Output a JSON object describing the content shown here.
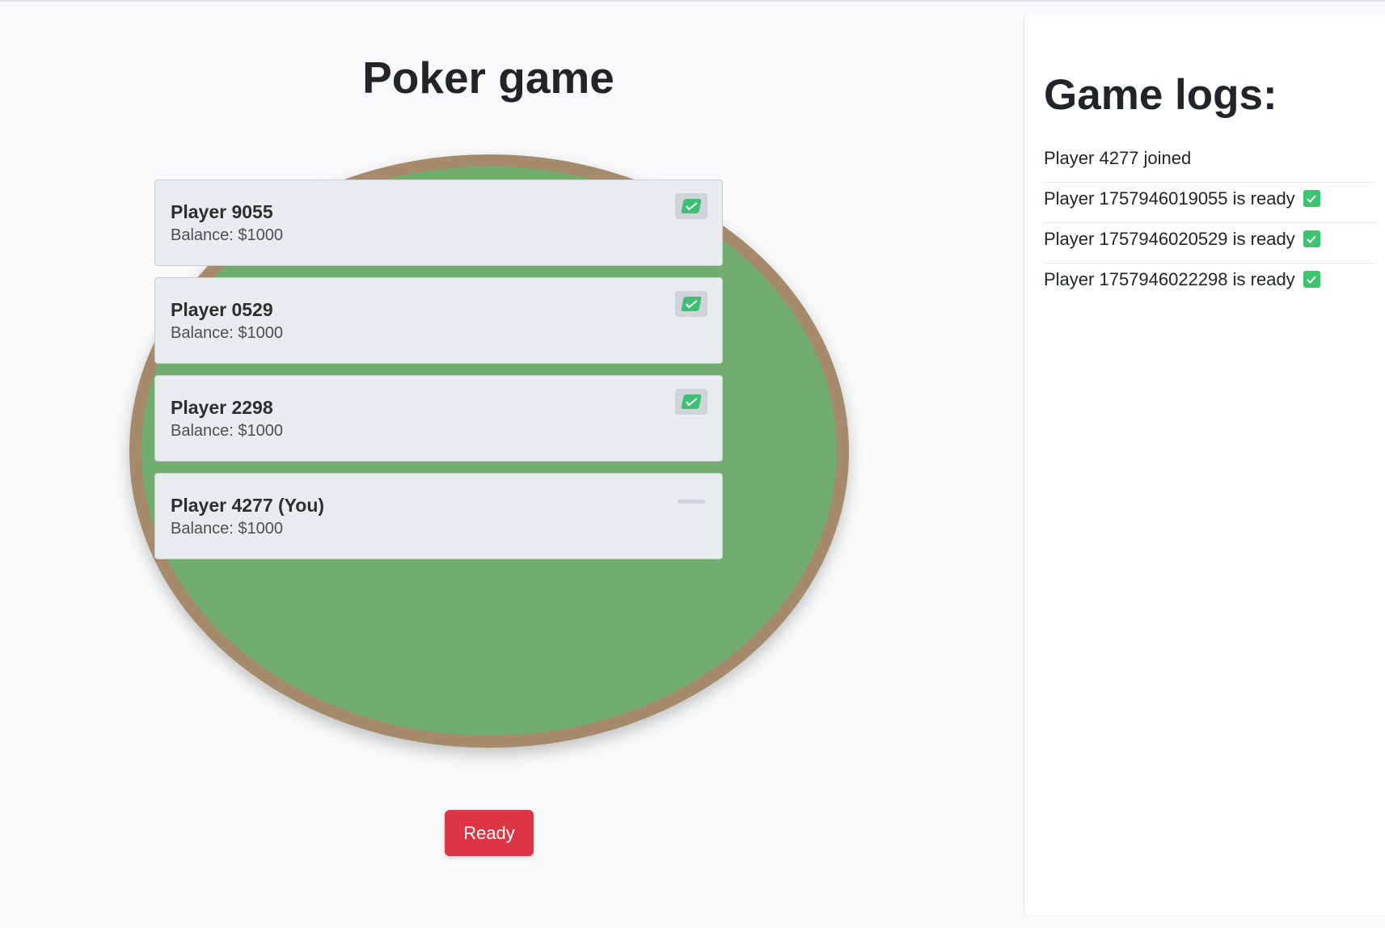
{
  "page": {
    "title": "Poker game"
  },
  "players": [
    {
      "name": "Player 9055",
      "balance": "Balance: $1000",
      "ready": true
    },
    {
      "name": "Player 0529",
      "balance": "Balance: $1000",
      "ready": true
    },
    {
      "name": "Player 2298",
      "balance": "Balance: $1000",
      "ready": true
    },
    {
      "name": "Player 4277 (You)",
      "balance": "Balance: $1000",
      "ready": false
    }
  ],
  "controls": {
    "ready_label": "Ready"
  },
  "logs": {
    "title": "Game logs:",
    "entries": [
      {
        "text": "Player 4277 joined",
        "check": false
      },
      {
        "text": "Player 1757946019055 is ready",
        "check": true
      },
      {
        "text": "Player 1757946020529 is ready",
        "check": true
      },
      {
        "text": "Player 1757946022298 is ready",
        "check": true
      }
    ]
  },
  "icons": {
    "ready": "check-mark-icon",
    "waiting": "dash-icon"
  },
  "colors": {
    "felt": "#70ad6e",
    "table_rim": "#a58a6c",
    "ready_button": "#dc3545",
    "check_green": "#3fbf72"
  }
}
